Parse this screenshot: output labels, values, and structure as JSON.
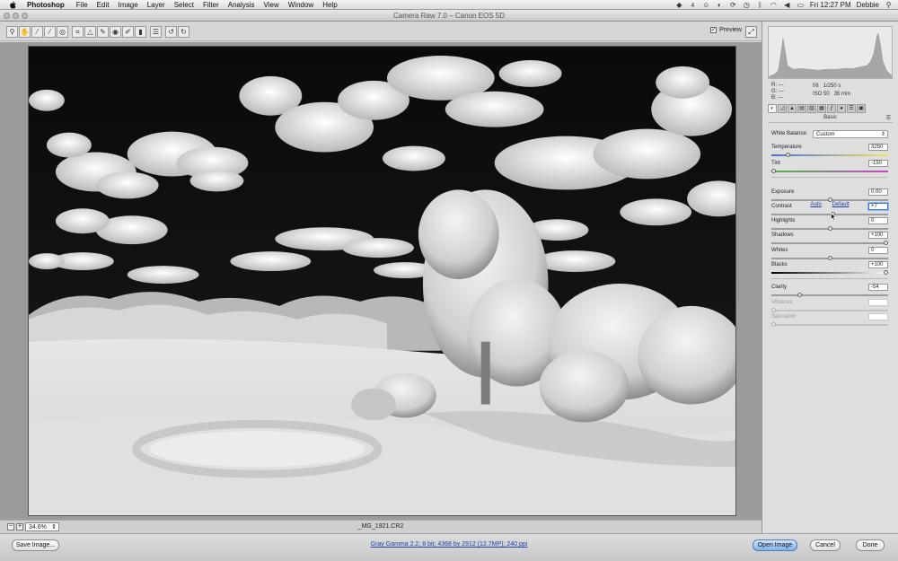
{
  "menubar": {
    "apple_icon": "apple-icon",
    "app_name": "Photoshop",
    "menus": [
      "File",
      "Edit",
      "Image",
      "Layer",
      "Select",
      "Filter",
      "Analysis",
      "View",
      "Window",
      "Help"
    ],
    "status_number": "4",
    "clock": "Fri 12:27 PM",
    "user": "Debbie"
  },
  "window": {
    "title": "Camera Raw 7.0  –  Canon EOS 5D"
  },
  "toolbar": {
    "tool_icons": [
      "zoom-tool-icon",
      "hand-tool-icon",
      "white-balance-tool-icon",
      "color-sampler-tool-icon",
      "targeted-adjustment-tool-icon",
      "crop-tool-icon",
      "straighten-tool-icon",
      "spot-removal-tool-icon",
      "red-eye-removal-tool-icon",
      "adjustment-brush-icon",
      "graduated-filter-icon",
      "preferences-icon",
      "rotate-left-icon",
      "rotate-right-icon"
    ],
    "preview_label": "Preview",
    "preview_checked": true
  },
  "canvas": {
    "zoom": "34.6%",
    "filename": "_MG_1921.CR2"
  },
  "footer": {
    "save_label": "Save Image...",
    "workflow_info": "Gray Gamma 2.2; 8 bit; 4368 by 2912 (12.7MP); 240 ppi",
    "open_label": "Open Image",
    "cancel_label": "Cancel",
    "done_label": "Done"
  },
  "histogram": {
    "readout": {
      "r": "R:  ---",
      "g": "G:  ---",
      "b": "B:  ---"
    },
    "aperture": "f/8",
    "shutter": "1/250 s",
    "iso": "ISO 50",
    "focal": "35 mm"
  },
  "panel": {
    "tab_icons": [
      "basic-tab-icon",
      "tone-curve-tab-icon",
      "detail-tab-icon",
      "hsl-tab-icon",
      "split-toning-tab-icon",
      "lens-corrections-tab-icon",
      "effects-tab-icon",
      "camera-calibration-tab-icon",
      "presets-tab-icon",
      "snapshots-tab-icon"
    ],
    "title": "Basic",
    "white_balance_label": "White Balance:",
    "white_balance_value": "Custom",
    "auto_label": "Auto",
    "default_label": "Default",
    "sliders": [
      {
        "label": "Temperature",
        "value": "3250",
        "fraction": 0.13,
        "enabled": true
      },
      {
        "label": "Tint",
        "value": "-150",
        "fraction": 0.0,
        "enabled": true
      },
      {
        "label": "Exposure",
        "value": "0.00",
        "fraction": 0.5,
        "enabled": true
      },
      {
        "label": "Contrast",
        "value": "+7",
        "fraction": 0.53,
        "enabled": true
      },
      {
        "label": "Highlights",
        "value": "0",
        "fraction": 0.5,
        "enabled": true
      },
      {
        "label": "Shadows",
        "value": "+100",
        "fraction": 1.0,
        "enabled": true
      },
      {
        "label": "Whites",
        "value": "0",
        "fraction": 0.5,
        "enabled": true
      },
      {
        "label": "Blacks",
        "value": "+100",
        "fraction": 1.0,
        "enabled": true
      },
      {
        "label": "Clarity",
        "value": "-54",
        "fraction": 0.23,
        "enabled": true
      },
      {
        "label": "Vibrance",
        "value": "",
        "fraction": 0.0,
        "enabled": false
      },
      {
        "label": "Saturation",
        "value": "",
        "fraction": 0.0,
        "enabled": false
      }
    ]
  }
}
